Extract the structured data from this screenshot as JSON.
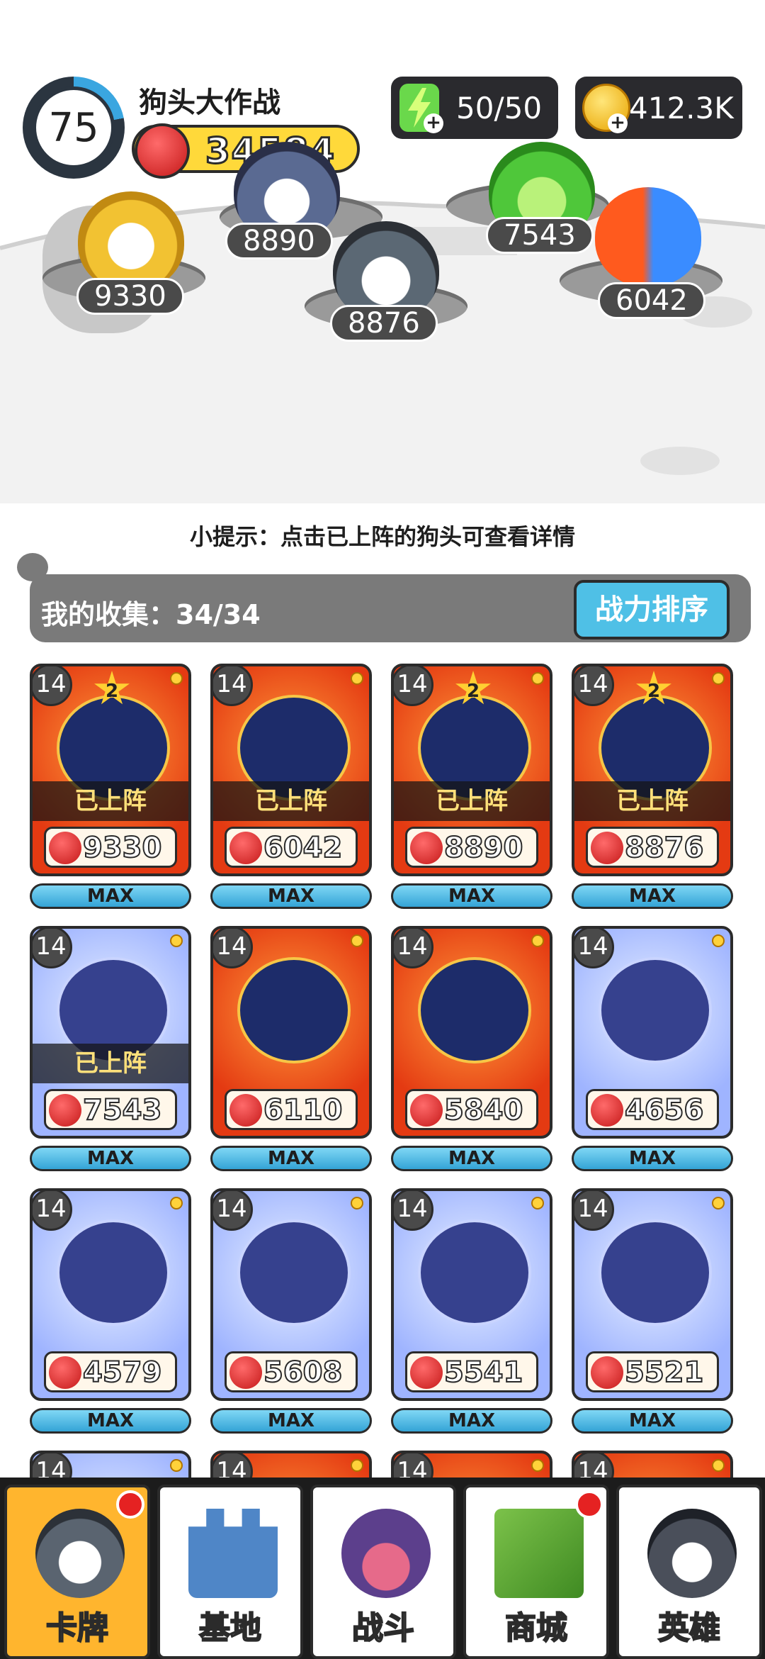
{
  "header": {
    "level": "75",
    "title": "狗头大作战",
    "total_power": "34584",
    "energy": "50/50",
    "coins": "412.3K",
    "level_progress": 0.22
  },
  "arena": {
    "slots": [
      {
        "power": "9330",
        "icon": "golden-helmet-dog-icon"
      },
      {
        "power": "8890",
        "icon": "crowned-laser-dog-icon"
      },
      {
        "power": "8876",
        "icon": "glitch-dog-icon"
      },
      {
        "power": "7543",
        "icon": "cabbage-dog-icon"
      },
      {
        "power": "6042",
        "icon": "fire-ice-dog-icon"
      }
    ]
  },
  "tip": "小提示：点击已上阵的狗头可查看详情",
  "collection": {
    "label": "我的收集：34/34",
    "sort_button": "战力排序"
  },
  "cards": [
    {
      "level": "14",
      "stars": "2",
      "deployed": "已上阵",
      "power": "9330",
      "max": "MAX",
      "theme": "red"
    },
    {
      "level": "14",
      "deployed": "已上阵",
      "power": "6042",
      "max": "MAX",
      "theme": "red"
    },
    {
      "level": "14",
      "stars": "2",
      "deployed": "已上阵",
      "power": "8890",
      "max": "MAX",
      "theme": "red"
    },
    {
      "level": "14",
      "stars": "2",
      "deployed": "已上阵",
      "power": "8876",
      "max": "MAX",
      "theme": "red"
    },
    {
      "level": "14",
      "deployed": "已上阵",
      "power": "7543",
      "max": "MAX",
      "theme": "blue"
    },
    {
      "level": "14",
      "power": "6110",
      "max": "MAX",
      "theme": "red"
    },
    {
      "level": "14",
      "power": "5840",
      "max": "MAX",
      "theme": "red"
    },
    {
      "level": "14",
      "power": "4656",
      "max": "MAX",
      "theme": "blue"
    },
    {
      "level": "14",
      "power": "4579",
      "max": "MAX",
      "theme": "blue"
    },
    {
      "level": "14",
      "power": "5608",
      "max": "MAX",
      "theme": "blue"
    },
    {
      "level": "14",
      "power": "5541",
      "max": "MAX",
      "theme": "blue"
    },
    {
      "level": "14",
      "power": "5521",
      "max": "MAX",
      "theme": "blue"
    },
    {
      "level": "14",
      "theme": "blue"
    },
    {
      "level": "14",
      "theme": "red"
    },
    {
      "level": "14",
      "theme": "red"
    },
    {
      "level": "14",
      "theme": "red"
    }
  ],
  "nav": [
    {
      "label": "卡牌",
      "icon": "husky-card-icon",
      "active": true,
      "badge": true
    },
    {
      "label": "基地",
      "icon": "castle-icon",
      "active": false,
      "badge": false
    },
    {
      "label": "战斗",
      "icon": "paw-icon",
      "active": false,
      "badge": false
    },
    {
      "label": "商城",
      "icon": "money-icon",
      "active": false,
      "badge": true
    },
    {
      "label": "英雄",
      "icon": "hero-dog-icon",
      "active": false,
      "badge": false
    }
  ]
}
